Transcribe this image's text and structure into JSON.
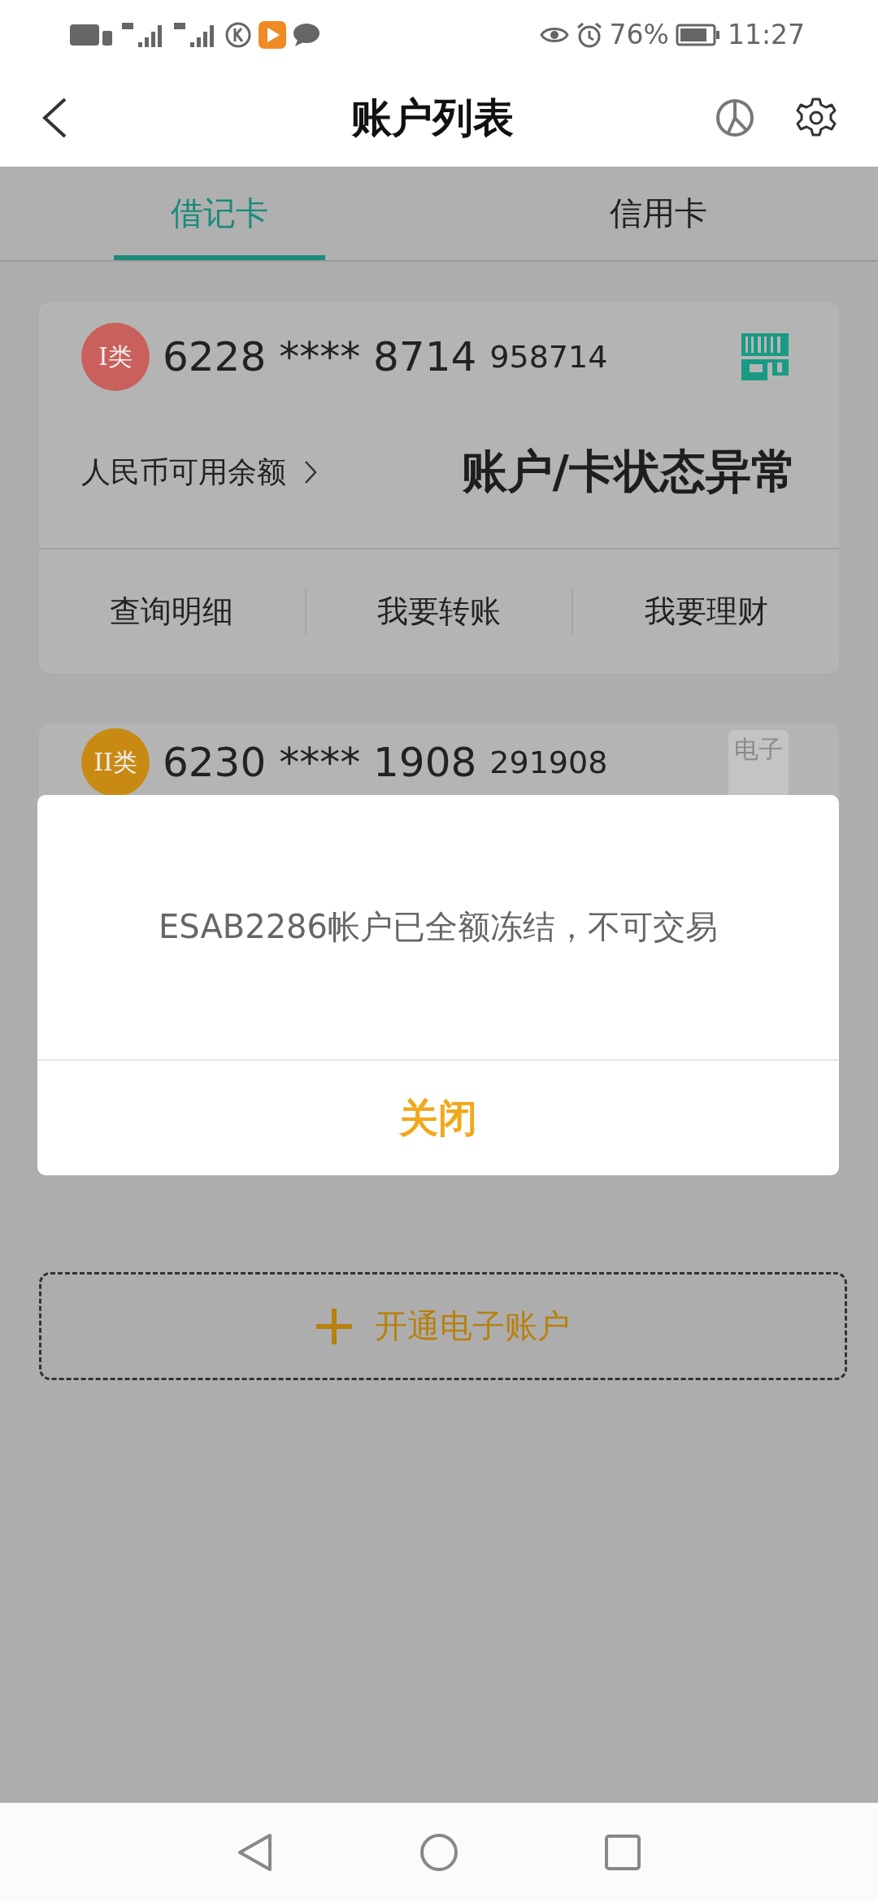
{
  "status_bar": {
    "battery": "76%",
    "time": "11:27"
  },
  "header": {
    "title": "账户列表"
  },
  "tabs": [
    {
      "label": "借记卡",
      "selected": true
    },
    {
      "label": "信用卡",
      "selected": false
    }
  ],
  "accounts": [
    {
      "class_badge": "I类",
      "color": "#c9605c",
      "number": "6228 **** 8714",
      "suffix": "958714",
      "balance_label": "人民币可用余额",
      "status": "账户/卡状态异常",
      "actions": [
        "查询明细",
        "我要转账",
        "我要理财"
      ]
    },
    {
      "class_badge": "II类",
      "color": "#c88a12",
      "number": "6230 **** 1908",
      "suffix": "291908",
      "tag": "电子"
    }
  ],
  "open_account_button": "开通电子账户",
  "dialog": {
    "message": "ESAB2286帐户已全额冻结，不可交易",
    "button": "关闭"
  }
}
